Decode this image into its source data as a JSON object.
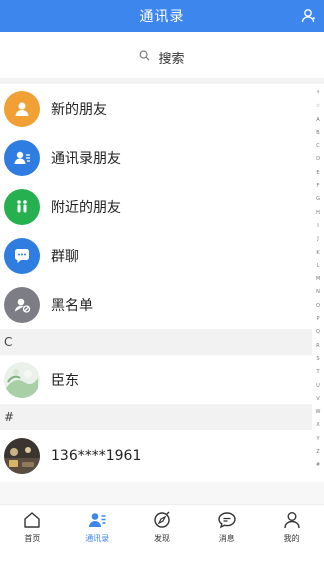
{
  "header": {
    "title": "通讯录",
    "user_icon": "user-icon"
  },
  "search": {
    "label": "搜索",
    "icon": "search-icon"
  },
  "menu": [
    {
      "label": "新的朋友",
      "color": "#f0a035",
      "icon": "new-friend-icon"
    },
    {
      "label": "通讯录朋友",
      "color": "#2f7de1",
      "icon": "contacts-friend-icon"
    },
    {
      "label": "附近的朋友",
      "color": "#27b04f",
      "icon": "nearby-friends-icon"
    },
    {
      "label": "群聊",
      "color": "#2f7de1",
      "icon": "group-chat-icon"
    },
    {
      "label": "黑名单",
      "color": "#7d7d85",
      "icon": "blacklist-icon"
    }
  ],
  "sections": [
    {
      "letter": "C",
      "contacts": [
        {
          "name": "臣东"
        }
      ]
    },
    {
      "letter": "#",
      "contacts": [
        {
          "name": "136****1961"
        }
      ]
    }
  ],
  "index_letters": [
    "↑",
    "☆",
    "A",
    "B",
    "C",
    "D",
    "E",
    "F",
    "G",
    "H",
    "I",
    "J",
    "K",
    "L",
    "M",
    "N",
    "O",
    "P",
    "Q",
    "R",
    "S",
    "T",
    "U",
    "V",
    "W",
    "X",
    "Y",
    "Z",
    "#"
  ],
  "tabs": [
    {
      "label": "首页",
      "icon": "home-icon",
      "active": false
    },
    {
      "label": "通讯录",
      "icon": "contacts-icon",
      "active": true
    },
    {
      "label": "发现",
      "icon": "discover-icon",
      "active": false
    },
    {
      "label": "消息",
      "icon": "message-icon",
      "active": false
    },
    {
      "label": "我的",
      "icon": "profile-icon",
      "active": false
    }
  ],
  "accent": "#3d86ee"
}
